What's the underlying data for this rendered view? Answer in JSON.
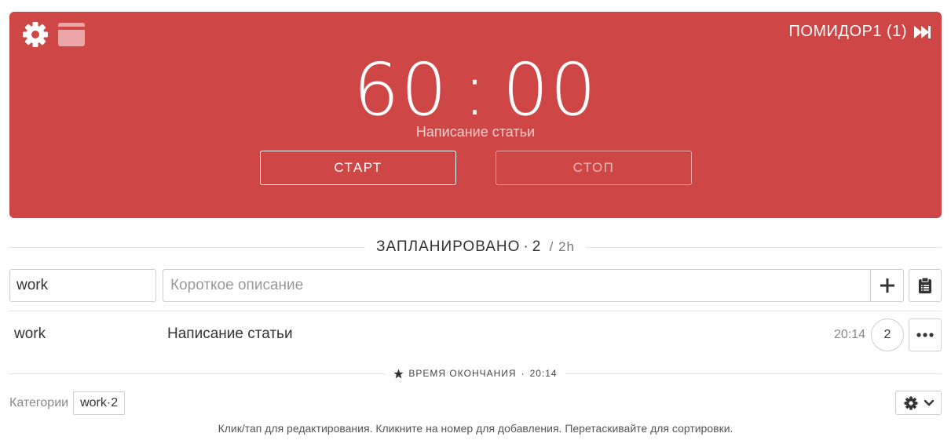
{
  "timer": {
    "minutes": "60",
    "separator": ":",
    "seconds": "00",
    "task": "Написание статьи",
    "pomodoro": "ПОМИДОР1 (1)",
    "start_label": "СТАРТ",
    "stop_label": "СТОП",
    "panel_color": "#cf4646"
  },
  "planned": {
    "title": "ЗАПЛАНИРОВАНО",
    "count": "2",
    "duration": "/ 2h"
  },
  "form": {
    "category_value": "work",
    "description_placeholder": "Короткое описание"
  },
  "tasks": [
    {
      "category": "work",
      "description": "Написание статьи",
      "end_time": "20:14",
      "count": "2"
    }
  ],
  "end_time": {
    "label": "ВРЕМЯ ОКОНЧАНИЯ",
    "value": "20:14"
  },
  "categories": {
    "label": "Категории",
    "tags": [
      {
        "name": "work",
        "count": "2"
      }
    ]
  },
  "footer": {
    "hint": "Клик/тап для редактирования. Кликните на номер для добавления. Перетаскивайте для сортировки."
  },
  "icons": {
    "settings": "gear-icon",
    "window": "window-icon",
    "skip": "fast-forward-icon",
    "add": "plus-icon",
    "clipboard": "clipboard-icon",
    "more": "ellipsis-icon",
    "star": "star-icon",
    "dropdown": "chevron-down-icon"
  }
}
